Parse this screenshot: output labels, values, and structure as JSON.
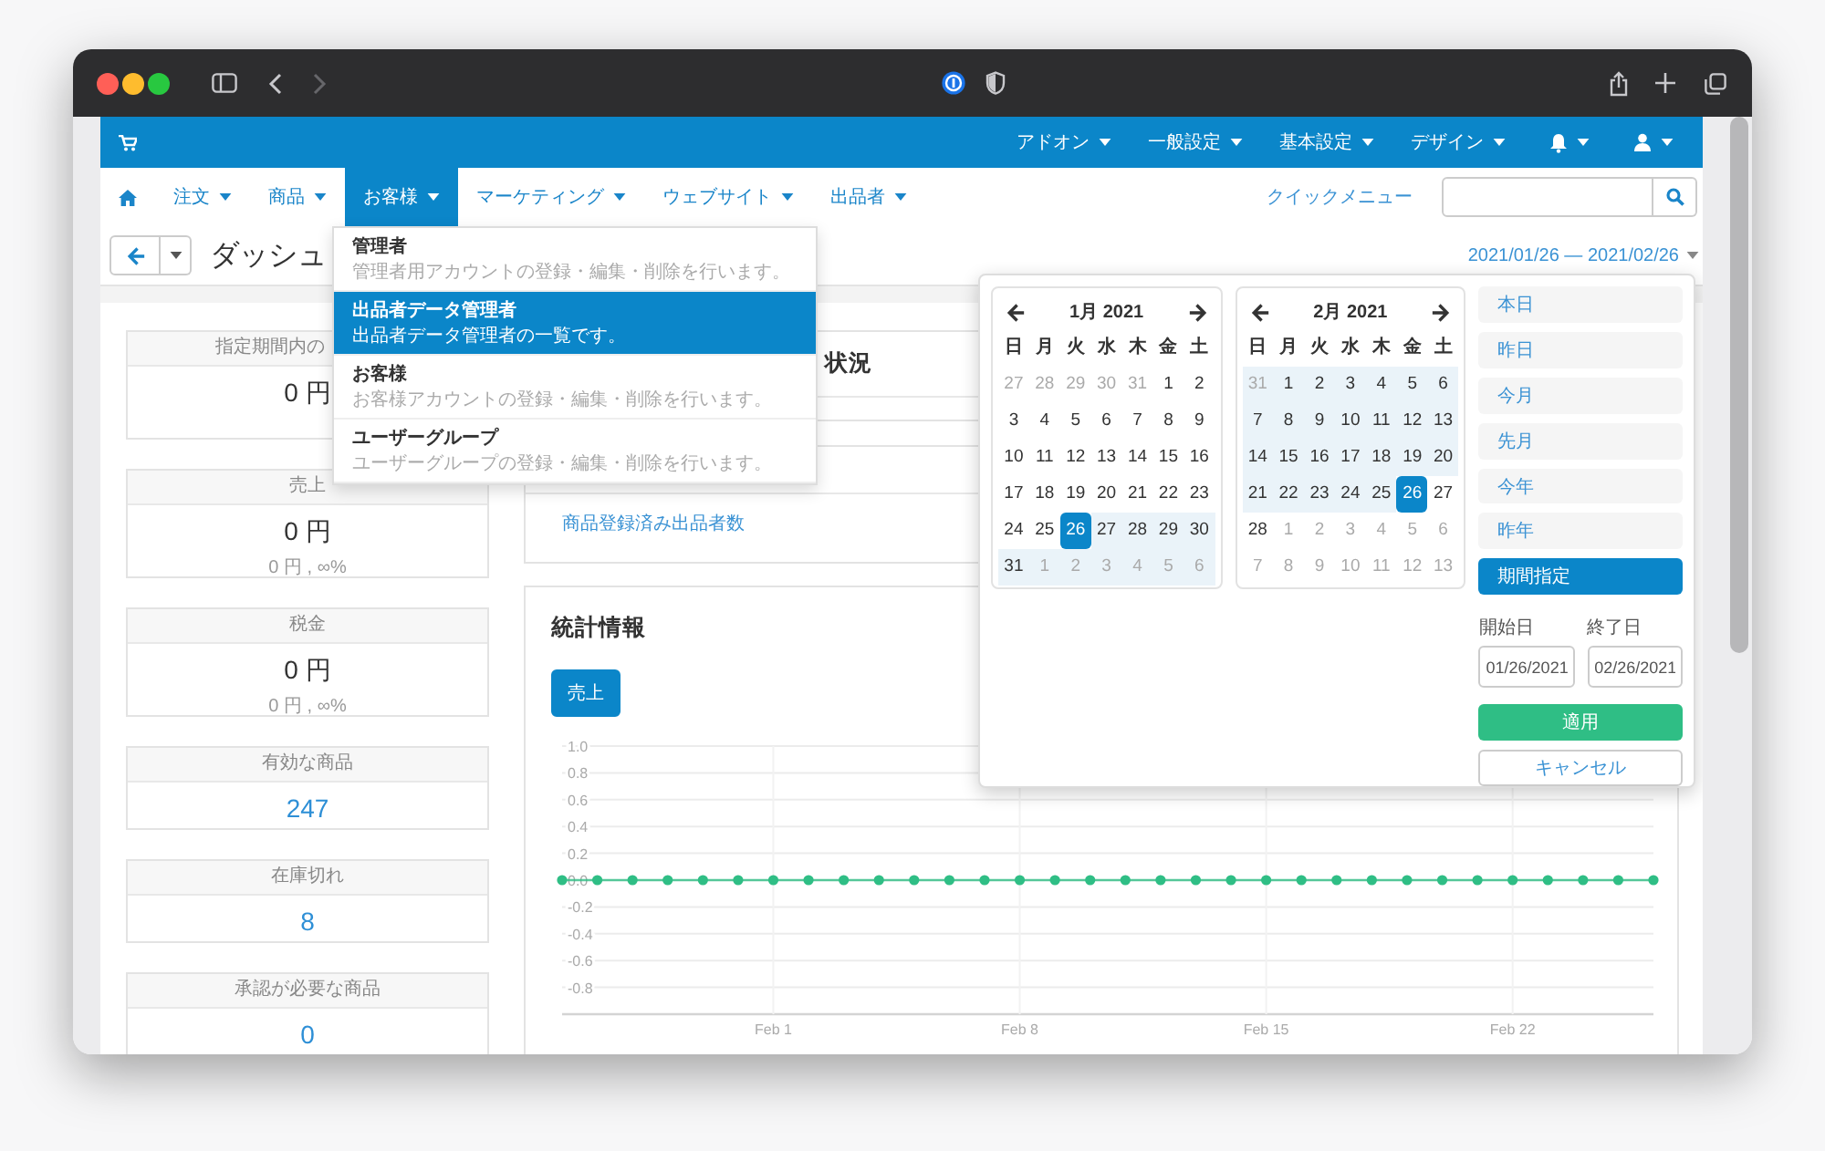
{
  "browser": {
    "forward_disabled": true
  },
  "top_bar": {
    "menus": [
      {
        "label": "アドオン"
      },
      {
        "label": "一般設定"
      },
      {
        "label": "基本設定"
      },
      {
        "label": "デザイン"
      }
    ]
  },
  "nav": {
    "items": [
      {
        "label": "注文",
        "selected": false
      },
      {
        "label": "商品",
        "selected": false
      },
      {
        "label": "お客様",
        "selected": true
      },
      {
        "label": "マーケティング",
        "selected": false
      },
      {
        "label": "ウェブサイト",
        "selected": false
      },
      {
        "label": "出品者",
        "selected": false
      }
    ],
    "quick_menu": "クイックメニュー"
  },
  "header": {
    "title": "ダッシュ",
    "date_range": "2021/01/26 — 2021/02/26"
  },
  "customer_menu": {
    "items": [
      {
        "title": "管理者",
        "description": "管理者用アカウントの登録・編集・削除を行います。",
        "selected": false
      },
      {
        "title": "出品者データ管理者",
        "description": "出品者データ管理者の一覧です。",
        "selected": true
      },
      {
        "title": "お客様",
        "description": "お客様アカウントの登録・編集・削除を行います。",
        "selected": false
      },
      {
        "title": "ユーザーグループ",
        "description": "ユーザーグループの登録・編集・削除を行います。",
        "selected": false
      }
    ]
  },
  "stat_cards": [
    {
      "label": "指定期間内の",
      "value": "0 円",
      "highlight": false
    },
    {
      "label": "売上",
      "value": "0 円",
      "detail": "0 円 , ∞%",
      "highlight": false
    },
    {
      "label": "税金",
      "value": "0 円",
      "detail": "0 円 , ∞%",
      "highlight": false
    },
    {
      "label": "有効な商品",
      "value": "247",
      "highlight": true
    },
    {
      "label": "在庫切れ",
      "value": "8",
      "highlight": true
    },
    {
      "label": "承認が必要な商品",
      "value": "0",
      "highlight": true
    }
  ],
  "panels": {
    "status_title": "状況",
    "sellers_link": "商品登録済み出品者数",
    "stats_title": "統計情報",
    "metric_button": {
      "label": "売上",
      "selected": true
    },
    "chart_data": {
      "type": "line",
      "categories": [
        null,
        null,
        null,
        null,
        null,
        null,
        "Feb 1",
        null,
        null,
        null,
        null,
        null,
        null,
        "Feb 8",
        null,
        null,
        null,
        null,
        null,
        null,
        "Feb 15",
        null,
        null,
        null,
        null,
        null,
        null,
        "Feb 22",
        null,
        null,
        null,
        null
      ],
      "grid": true,
      "ylim": [
        -1,
        1
      ],
      "yticks": [
        {
          "value": 1,
          "label": "1.0"
        },
        {
          "value": 0.8,
          "label": "0.8"
        },
        {
          "value": 0.6,
          "label": "0.6"
        },
        {
          "value": 0.4,
          "label": "0.4"
        },
        {
          "value": 0.2,
          "label": "0.2"
        },
        {
          "value": 0,
          "label": "0.0"
        },
        {
          "value": -0.2,
          "label": "-0.2"
        },
        {
          "value": -0.4,
          "label": "-0.4"
        },
        {
          "value": -0.6,
          "label": "-0.6"
        },
        {
          "value": -0.8,
          "label": "-0.8"
        }
      ],
      "series": [
        {
          "color": "#2fbe85",
          "marker": "circle",
          "values": [
            0,
            0,
            0,
            0,
            0,
            0,
            0,
            0,
            0,
            0,
            0,
            0,
            0,
            0,
            0,
            0,
            0,
            0,
            0,
            0,
            0,
            0,
            0,
            0,
            0,
            0,
            0,
            0,
            0,
            0,
            0,
            0
          ]
        }
      ]
    }
  },
  "date_picker": {
    "calendars": [
      {
        "title": "1月 2021",
        "weekdays": [
          "日",
          "月",
          "火",
          "水",
          "木",
          "金",
          "土"
        ],
        "weeks": [
          [
            {
              "day": "27",
              "other_month": true,
              "in_range": false,
              "selected": false
            },
            {
              "day": "28",
              "other_month": true,
              "in_range": false,
              "selected": false
            },
            {
              "day": "29",
              "other_month": true,
              "in_range": false,
              "selected": false
            },
            {
              "day": "30",
              "other_month": true,
              "in_range": false,
              "selected": false
            },
            {
              "day": "31",
              "other_month": true,
              "in_range": false,
              "selected": false
            },
            {
              "day": "1",
              "other_month": false,
              "in_range": false,
              "selected": false
            },
            {
              "day": "2",
              "other_month": false,
              "in_range": false,
              "selected": false
            }
          ],
          [
            {
              "day": "3",
              "other_month": false,
              "in_range": false,
              "selected": false
            },
            {
              "day": "4",
              "other_month": false,
              "in_range": false,
              "selected": false
            },
            {
              "day": "5",
              "other_month": false,
              "in_range": false,
              "selected": false
            },
            {
              "day": "6",
              "other_month": false,
              "in_range": false,
              "selected": false
            },
            {
              "day": "7",
              "other_month": false,
              "in_range": false,
              "selected": false
            },
            {
              "day": "8",
              "other_month": false,
              "in_range": false,
              "selected": false
            },
            {
              "day": "9",
              "other_month": false,
              "in_range": false,
              "selected": false
            }
          ],
          [
            {
              "day": "10",
              "other_month": false,
              "in_range": false,
              "selected": false
            },
            {
              "day": "11",
              "other_month": false,
              "in_range": false,
              "selected": false
            },
            {
              "day": "12",
              "other_month": false,
              "in_range": false,
              "selected": false
            },
            {
              "day": "13",
              "other_month": false,
              "in_range": false,
              "selected": false
            },
            {
              "day": "14",
              "other_month": false,
              "in_range": false,
              "selected": false
            },
            {
              "day": "15",
              "other_month": false,
              "in_range": false,
              "selected": false
            },
            {
              "day": "16",
              "other_month": false,
              "in_range": false,
              "selected": false
            }
          ],
          [
            {
              "day": "17",
              "other_month": false,
              "in_range": false,
              "selected": false
            },
            {
              "day": "18",
              "other_month": false,
              "in_range": false,
              "selected": false
            },
            {
              "day": "19",
              "other_month": false,
              "in_range": false,
              "selected": false
            },
            {
              "day": "20",
              "other_month": false,
              "in_range": false,
              "selected": false
            },
            {
              "day": "21",
              "other_month": false,
              "in_range": false,
              "selected": false
            },
            {
              "day": "22",
              "other_month": false,
              "in_range": false,
              "selected": false
            },
            {
              "day": "23",
              "other_month": false,
              "in_range": false,
              "selected": false
            }
          ],
          [
            {
              "day": "24",
              "other_month": false,
              "in_range": false,
              "selected": false
            },
            {
              "day": "25",
              "other_month": false,
              "in_range": false,
              "selected": false
            },
            {
              "day": "26",
              "other_month": false,
              "in_range": true,
              "selected": true
            },
            {
              "day": "27",
              "other_month": false,
              "in_range": true,
              "selected": false
            },
            {
              "day": "28",
              "other_month": false,
              "in_range": true,
              "selected": false
            },
            {
              "day": "29",
              "other_month": false,
              "in_range": true,
              "selected": false
            },
            {
              "day": "30",
              "other_month": false,
              "in_range": true,
              "selected": false
            }
          ],
          [
            {
              "day": "31",
              "other_month": false,
              "in_range": true,
              "selected": false
            },
            {
              "day": "1",
              "other_month": true,
              "in_range": true,
              "selected": false
            },
            {
              "day": "2",
              "other_month": true,
              "in_range": true,
              "selected": false
            },
            {
              "day": "3",
              "other_month": true,
              "in_range": true,
              "selected": false
            },
            {
              "day": "4",
              "other_month": true,
              "in_range": true,
              "selected": false
            },
            {
              "day": "5",
              "other_month": true,
              "in_range": true,
              "selected": false
            },
            {
              "day": "6",
              "other_month": true,
              "in_range": true,
              "selected": false
            }
          ]
        ]
      },
      {
        "title": "2月 2021",
        "weekdays": [
          "日",
          "月",
          "火",
          "水",
          "木",
          "金",
          "土"
        ],
        "weeks": [
          [
            {
              "day": "31",
              "other_month": true,
              "in_range": true,
              "selected": false
            },
            {
              "day": "1",
              "other_month": false,
              "in_range": true,
              "selected": false
            },
            {
              "day": "2",
              "other_month": false,
              "in_range": true,
              "selected": false
            },
            {
              "day": "3",
              "other_month": false,
              "in_range": true,
              "selected": false
            },
            {
              "day": "4",
              "other_month": false,
              "in_range": true,
              "selected": false
            },
            {
              "day": "5",
              "other_month": false,
              "in_range": true,
              "selected": false
            },
            {
              "day": "6",
              "other_month": false,
              "in_range": true,
              "selected": false
            }
          ],
          [
            {
              "day": "7",
              "other_month": false,
              "in_range": true,
              "selected": false
            },
            {
              "day": "8",
              "other_month": false,
              "in_range": true,
              "selected": false
            },
            {
              "day": "9",
              "other_month": false,
              "in_range": true,
              "selected": false
            },
            {
              "day": "10",
              "other_month": false,
              "in_range": true,
              "selected": false
            },
            {
              "day": "11",
              "other_month": false,
              "in_range": true,
              "selected": false
            },
            {
              "day": "12",
              "other_month": false,
              "in_range": true,
              "selected": false
            },
            {
              "day": "13",
              "other_month": false,
              "in_range": true,
              "selected": false
            }
          ],
          [
            {
              "day": "14",
              "other_month": false,
              "in_range": true,
              "selected": false
            },
            {
              "day": "15",
              "other_month": false,
              "in_range": true,
              "selected": false
            },
            {
              "day": "16",
              "other_month": false,
              "in_range": true,
              "selected": false
            },
            {
              "day": "17",
              "other_month": false,
              "in_range": true,
              "selected": false
            },
            {
              "day": "18",
              "other_month": false,
              "in_range": true,
              "selected": false
            },
            {
              "day": "19",
              "other_month": false,
              "in_range": true,
              "selected": false
            },
            {
              "day": "20",
              "other_month": false,
              "in_range": true,
              "selected": false
            }
          ],
          [
            {
              "day": "21",
              "other_month": false,
              "in_range": true,
              "selected": false
            },
            {
              "day": "22",
              "other_month": false,
              "in_range": true,
              "selected": false
            },
            {
              "day": "23",
              "other_month": false,
              "in_range": true,
              "selected": false
            },
            {
              "day": "24",
              "other_month": false,
              "in_range": true,
              "selected": false
            },
            {
              "day": "25",
              "other_month": false,
              "in_range": true,
              "selected": false
            },
            {
              "day": "26",
              "other_month": false,
              "in_range": true,
              "selected": true
            },
            {
              "day": "27",
              "other_month": false,
              "in_range": false,
              "selected": false
            }
          ],
          [
            {
              "day": "28",
              "other_month": false,
              "in_range": false,
              "selected": false
            },
            {
              "day": "1",
              "other_month": true,
              "in_range": false,
              "selected": false
            },
            {
              "day": "2",
              "other_month": true,
              "in_range": false,
              "selected": false
            },
            {
              "day": "3",
              "other_month": true,
              "in_range": false,
              "selected": false
            },
            {
              "day": "4",
              "other_month": true,
              "in_range": false,
              "selected": false
            },
            {
              "day": "5",
              "other_month": true,
              "in_range": false,
              "selected": false
            },
            {
              "day": "6",
              "other_month": true,
              "in_range": false,
              "selected": false
            }
          ],
          [
            {
              "day": "7",
              "other_month": true,
              "in_range": false,
              "selected": false
            },
            {
              "day": "8",
              "other_month": true,
              "in_range": false,
              "selected": false
            },
            {
              "day": "9",
              "other_month": true,
              "in_range": false,
              "selected": false
            },
            {
              "day": "10",
              "other_month": true,
              "in_range": false,
              "selected": false
            },
            {
              "day": "11",
              "other_month": true,
              "in_range": false,
              "selected": false
            },
            {
              "day": "12",
              "other_month": true,
              "in_range": false,
              "selected": false
            },
            {
              "day": "13",
              "other_month": true,
              "in_range": false,
              "selected": false
            }
          ]
        ]
      }
    ],
    "ranges": [
      {
        "label": "本日",
        "selected": false
      },
      {
        "label": "昨日",
        "selected": false
      },
      {
        "label": "今月",
        "selected": false
      },
      {
        "label": "先月",
        "selected": false
      },
      {
        "label": "今年",
        "selected": false
      },
      {
        "label": "昨年",
        "selected": false
      },
      {
        "label": "期間指定",
        "selected": true
      }
    ],
    "start_label": "開始日",
    "end_label": "終了日",
    "start_value": "01/26/2021",
    "end_value": "02/26/2021",
    "apply": "適用",
    "cancel": "キャンセル"
  }
}
